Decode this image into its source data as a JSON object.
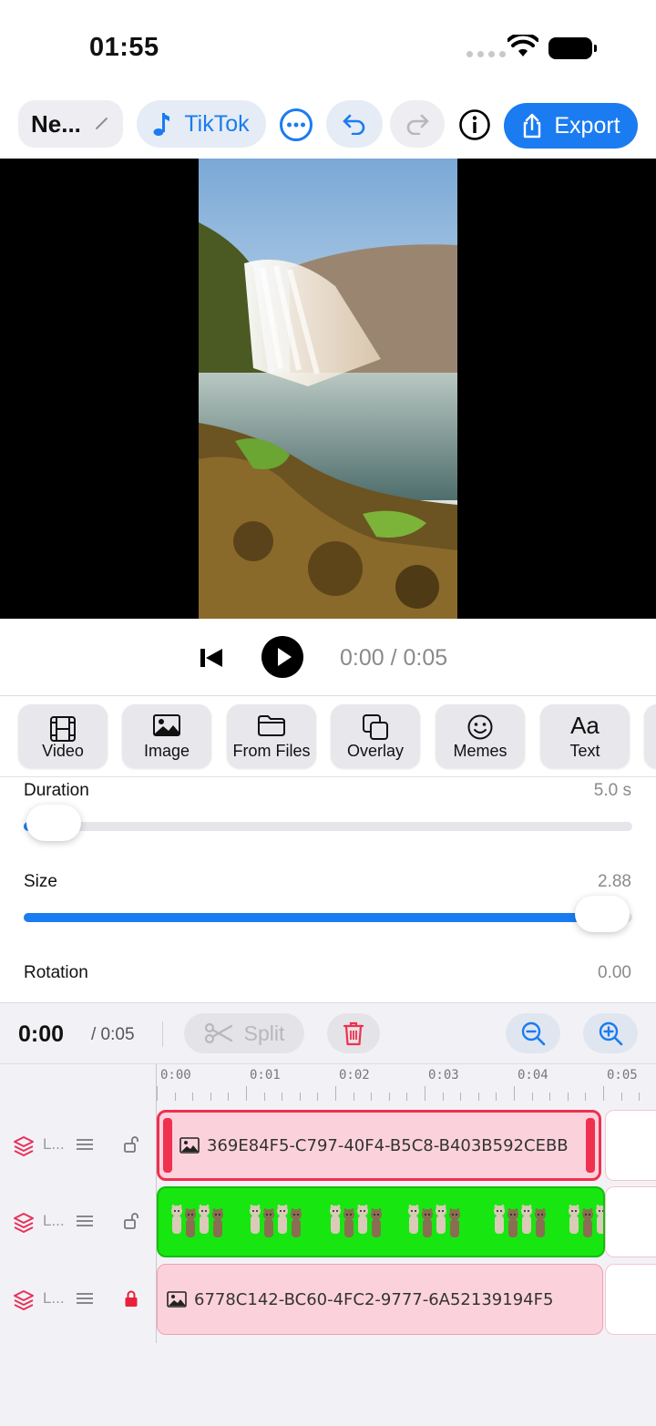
{
  "status": {
    "time": "01:55"
  },
  "toolbar": {
    "project_title": "Ne...",
    "format_label": "TikTok",
    "export_label": "Export"
  },
  "player": {
    "time_readout": "0:00 / 0:05"
  },
  "media_buttons": [
    {
      "label": "Video",
      "icon": "film-icon"
    },
    {
      "label": "Image",
      "icon": "image-icon"
    },
    {
      "label": "From Files",
      "icon": "folder-icon"
    },
    {
      "label": "Overlay",
      "icon": "overlay-icon"
    },
    {
      "label": "Memes",
      "icon": "smiley-icon"
    },
    {
      "label": "Text",
      "icon": "text-aa-icon",
      "glyph": "Aa"
    }
  ],
  "properties": {
    "duration": {
      "label": "Duration",
      "value": "5.0 s",
      "fraction": 0.05
    },
    "size": {
      "label": "Size",
      "value": "2.88",
      "fraction": 0.95
    },
    "rotation": {
      "label": "Rotation",
      "value": "0.00"
    }
  },
  "timeline": {
    "current_time": "0:00",
    "total_time": "/ 0:05",
    "split_label": "Split",
    "ruler_labels": [
      "0:00",
      "0:01",
      "0:02",
      "0:03",
      "0:04",
      "0:05"
    ],
    "tracks": [
      {
        "name": "L...",
        "locked": false,
        "clip_name": "369E84F5-C797-40F4-B5C8-B403B592CEBB",
        "clip_kind": "image",
        "selected": true
      },
      {
        "name": "L...",
        "locked": false,
        "clip_name": "",
        "clip_kind": "video",
        "selected": false
      },
      {
        "name": "L...",
        "locked": true,
        "clip_name": "6778C142-BC60-4FC2-9777-6A52139194F5",
        "clip_kind": "image",
        "selected": false
      }
    ]
  },
  "colors": {
    "accent": "#1a7cf0",
    "selected_clip": "#f0304f",
    "green_screen": "#18e610",
    "lock_red": "#e8203c"
  }
}
